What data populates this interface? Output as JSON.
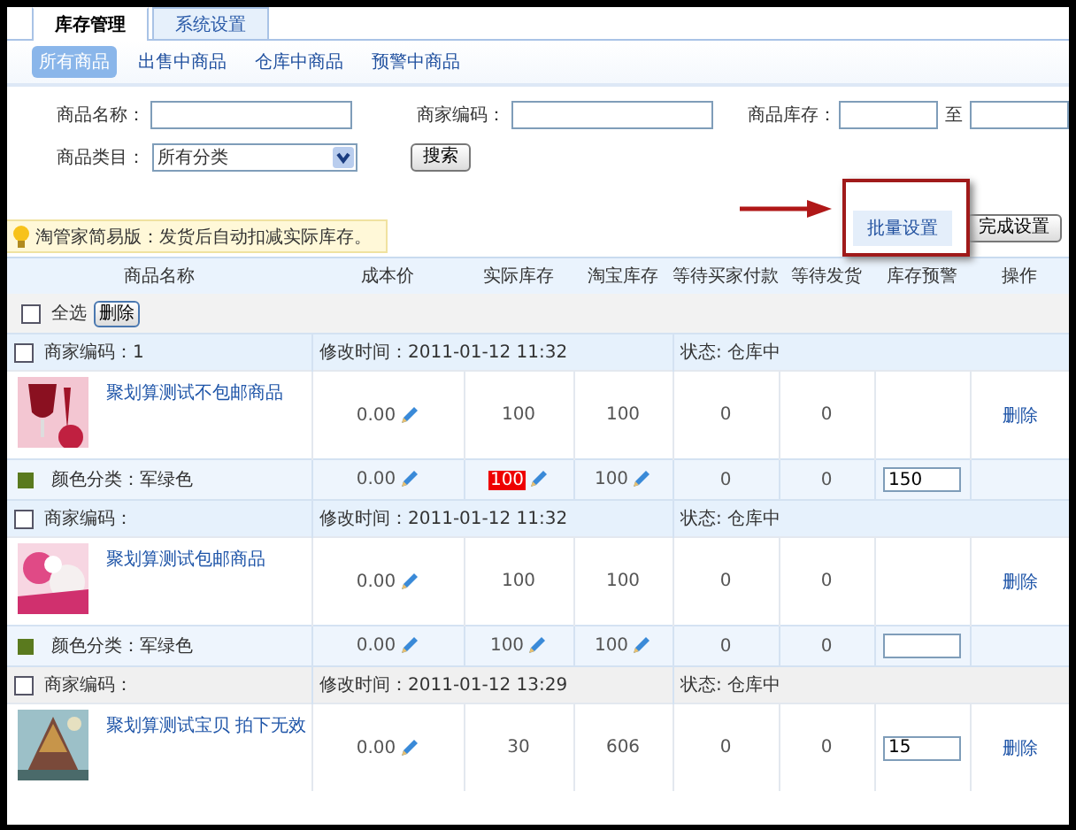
{
  "tabs": [
    {
      "label": "库存管理",
      "selected": true
    },
    {
      "label": "系统设置",
      "selected": false
    }
  ],
  "subtabs": [
    {
      "label": "所有商品",
      "selected": true
    },
    {
      "label": "出售中商品",
      "selected": false
    },
    {
      "label": "仓库中商品",
      "selected": false
    },
    {
      "label": "预警中商品",
      "selected": false
    }
  ],
  "filters": {
    "name_label": "商品名称：",
    "code_label": "商家编码：",
    "stock_label": "商品库存：",
    "stock_to": "至",
    "category_label": "商品类目：",
    "category_value": "所有分类",
    "search_button": "搜索"
  },
  "batch_button": "批量设置",
  "done_button": "完成设置",
  "notice": "淘管家简易版：发货后自动扣减实际库存。",
  "columns": [
    "商品名称",
    "成本价",
    "实际库存",
    "淘宝库存",
    "等待买家付款",
    "等待发货",
    "库存预警",
    "操作"
  ],
  "select_all": {
    "label": "全选",
    "checked": false
  },
  "delete_button": "删除",
  "products": [
    {
      "checked": false,
      "hovered": false,
      "code": "商家编码：1",
      "modified": "修改时间：2011-01-12 11:32",
      "status": "状态: 仓库中",
      "name": "聚划算测试不包邮商品",
      "cost": "0.00",
      "actual": "100",
      "taobao": "100",
      "awaiting_payment": "0",
      "awaiting_shipment": "0",
      "warning_field": false,
      "action": "删除",
      "variants": [
        {
          "color": "#5a7a1e",
          "label": "颜色分类：军绿色",
          "cost": "0.00",
          "actual": "100",
          "actual_alert": true,
          "taobao": "100",
          "awaiting_payment": "0",
          "awaiting_shipment": "0",
          "warning_field": true,
          "warning": "150"
        }
      ]
    },
    {
      "checked": false,
      "hovered": false,
      "code": "商家编码：",
      "modified": "修改时间：2011-01-12 11:32",
      "status": "状态: 仓库中",
      "name": "聚划算测试包邮商品",
      "cost": "0.00",
      "actual": "100",
      "taobao": "100",
      "awaiting_payment": "0",
      "awaiting_shipment": "0",
      "warning_field": false,
      "action": "删除",
      "variants": [
        {
          "color": "#5a7a1e",
          "label": "颜色分类：军绿色",
          "cost": "0.00",
          "actual": "100",
          "actual_alert": false,
          "taobao": "100",
          "awaiting_payment": "0",
          "awaiting_shipment": "0",
          "warning_field": true
        }
      ]
    },
    {
      "checked": false,
      "hovered": true,
      "code": "商家编码：",
      "modified": "修改时间：2011-01-12 13:29",
      "status": "状态: 仓库中",
      "name": "聚划算测试宝贝 拍下无效",
      "cost": "0.00",
      "actual": "30",
      "taobao": "606",
      "awaiting_payment": "0",
      "awaiting_shipment": "0",
      "warning_field": true,
      "warning": "15",
      "action": "删除"
    }
  ]
}
